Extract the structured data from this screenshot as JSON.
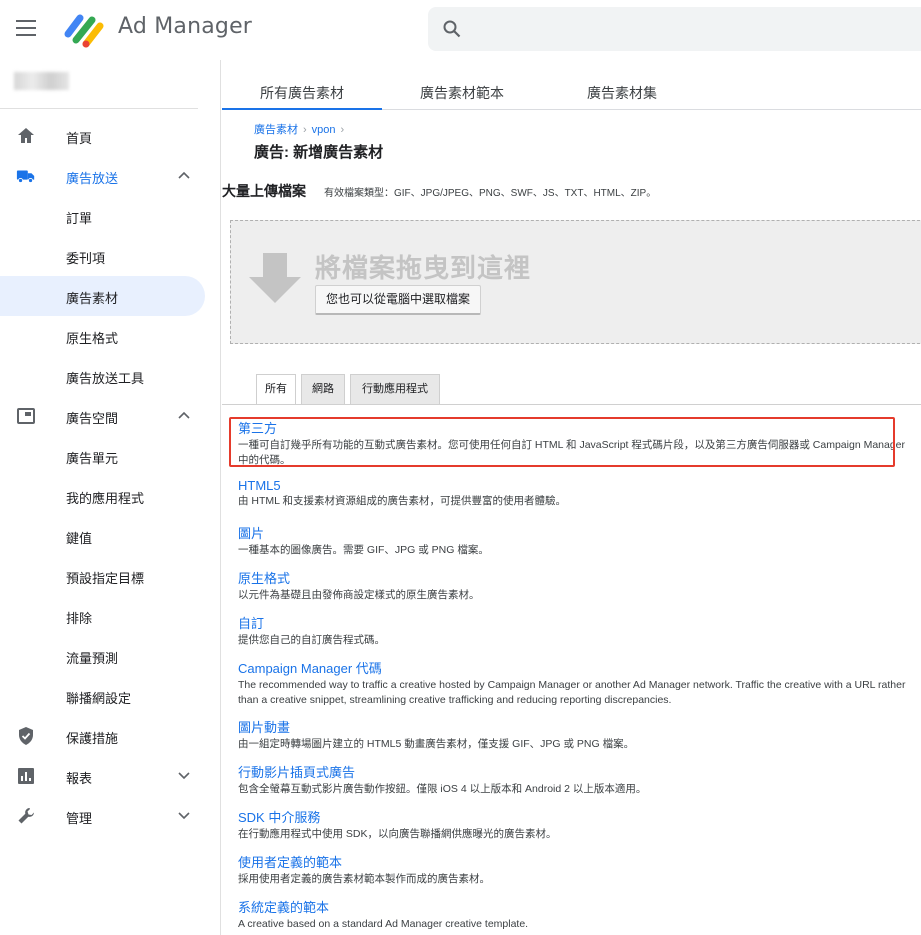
{
  "app": {
    "title": "Ad Manager"
  },
  "sidebar": {
    "items": [
      {
        "label": "首頁",
        "icon": "home-icon",
        "level": 0
      },
      {
        "label": "廣告放送",
        "icon": "truck-icon",
        "level": 0,
        "expanded": true
      },
      {
        "label": "訂單",
        "level": 1
      },
      {
        "label": "委刊項",
        "level": 1
      },
      {
        "label": "廣告素材",
        "level": 1,
        "active": true
      },
      {
        "label": "原生格式",
        "level": 1
      },
      {
        "label": "廣告放送工具",
        "level": 1
      },
      {
        "label": "廣告空間",
        "icon": "inventory-icon",
        "level": 0,
        "expanded": true
      },
      {
        "label": "廣告單元",
        "level": 1
      },
      {
        "label": "我的應用程式",
        "level": 1
      },
      {
        "label": "鍵值",
        "level": 1
      },
      {
        "label": "預設指定目標",
        "level": 1
      },
      {
        "label": "排除",
        "level": 1
      },
      {
        "label": "流量預測",
        "level": 1
      },
      {
        "label": "聯播網設定",
        "level": 1
      },
      {
        "label": "保護措施",
        "icon": "shield-icon",
        "level": 0
      },
      {
        "label": "報表",
        "icon": "bar-chart-icon",
        "level": 0,
        "expanded": false
      },
      {
        "label": "管理",
        "icon": "wrench-icon",
        "level": 0,
        "expanded": false
      }
    ]
  },
  "main": {
    "tabs": [
      {
        "label": "所有廣告素材"
      },
      {
        "label": "廣告素材範本"
      },
      {
        "label": "廣告素材集"
      }
    ],
    "breadcrumb": [
      "廣告素材",
      "vpon"
    ],
    "title": "廣告: 新增廣告素材",
    "bulk_upload": {
      "title": "大量上傳檔案",
      "types": "有效檔案類型：GIF、JPG/JPEG、PNG、SWF、JS、TXT、HTML、ZIP。",
      "drop_text": "將檔案拖曳到這裡",
      "choose_label": "您也可以從電腦中選取檔案"
    },
    "subtabs": [
      {
        "label": "所有"
      },
      {
        "label": "網路"
      },
      {
        "label": "行動應用程式"
      }
    ],
    "creative_types": [
      {
        "name": "第三方",
        "desc": "一種可自訂幾乎所有功能的互動式廣告素材。您可使用任何自訂 HTML 和 JavaScript 程式碼片段，以及第三方廣告伺服器或 Campaign Manager 中的代碼。"
      },
      {
        "name": "HTML5",
        "desc": "由 HTML 和支援素材資源組成的廣告素材，可提供豐富的使用者體驗。"
      },
      {
        "name": "圖片",
        "desc": "一種基本的圖像廣告。需要 GIF、JPG 或 PNG 檔案。"
      },
      {
        "name": "原生格式",
        "desc": "以元件為基礎且由發佈商設定樣式的原生廣告素材。"
      },
      {
        "name": "自訂",
        "desc": "提供您自己的自訂廣告程式碼。"
      },
      {
        "name": "Campaign Manager 代碼",
        "desc": "The recommended way to traffic a creative hosted by Campaign Manager or another Ad Manager network. Traffic the creative with a URL rather than a creative snippet, streamlining creative trafficking and reducing reporting discrepancies."
      },
      {
        "name": "圖片動畫",
        "desc": "由一組定時轉場圖片建立的 HTML5 動畫廣告素材，僅支援 GIF、JPG 或 PNG 檔案。"
      },
      {
        "name": "行動影片插頁式廣告",
        "desc": "包含全螢幕互動式影片廣告動作按鈕。僅限 iOS 4 以上版本和 Android 2 以上版本適用。"
      },
      {
        "name": "SDK 中介服務",
        "desc": "在行動應用程式中使用 SDK，以向廣告聯播網供應曝光的廣告素材。"
      },
      {
        "name": "使用者定義的範本",
        "desc": "採用使用者定義的廣告素材範本製作而成的廣告素材。"
      },
      {
        "name": "系統定義的範本",
        "desc": "A creative based on a standard Ad Manager creative template."
      }
    ]
  },
  "colors": {
    "accent": "#1a73e8",
    "highlight": "#e53b2c"
  }
}
